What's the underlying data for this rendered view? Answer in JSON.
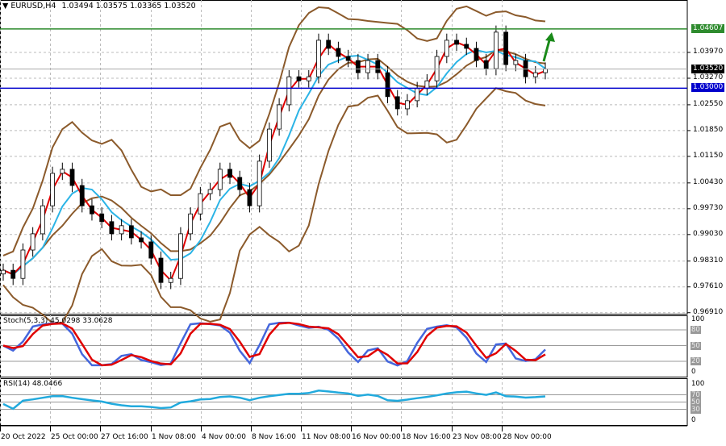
{
  "header": {
    "symbol_label": "EURUSD,H4",
    "ohlc": "1.03494 1.03575 1.03365 1.03520",
    "dropdown_icon": "triangle-down-icon"
  },
  "colors": {
    "band": "#8B5A2B",
    "fast_ma": "#e00000",
    "slow_ma": "#2bb4e6",
    "resistance": "#2e8b2e",
    "support": "#0000cc",
    "stoch_main": "#4466dd",
    "stoch_signal": "#e00000",
    "rsi": "#22aadd",
    "arrow": "#1a8a1a"
  },
  "chart_data": [
    {
      "type": "candlestick",
      "title": "EURUSD,H4",
      "ylim": [
        0.968,
        1.0485
      ],
      "price_ticks": [
        "1.03970",
        "1.03270",
        "1.02550",
        "1.01850",
        "1.01150",
        "1.00430",
        "0.99730",
        "0.99030",
        "0.98310",
        "0.97610",
        "0.96910"
      ],
      "current_price": "1.03520",
      "horizontal_lines": [
        {
          "name": "resistance",
          "value": "1.04607"
        },
        {
          "name": "support",
          "value": "1.03000"
        }
      ],
      "time_labels": [
        "20 Oct 2022",
        "25 Oct 00:00",
        "27 Oct 16:00",
        "1 Nov 08:00",
        "4 Nov 00:00",
        "8 Nov 16:00",
        "11 Nov 08:00",
        "16 Nov 00:00",
        "18 Nov 16:00",
        "23 Nov 08:00",
        "28 Nov 00:00"
      ],
      "closes": [
        0.9806,
        0.9784,
        0.9861,
        0.9905,
        0.9981,
        1.0069,
        1.008,
        1.0036,
        0.9981,
        0.9959,
        0.9938,
        0.9905,
        0.9927,
        0.9894,
        0.9883,
        0.9839,
        0.9773,
        0.9784,
        0.9905,
        0.9959,
        1.0014,
        1.0025,
        1.008,
        1.0058,
        1.0025,
        0.9981,
        1.0102,
        1.0189,
        1.0255,
        1.0331,
        1.032,
        1.0331,
        1.043,
        1.0408,
        1.0386,
        1.0375,
        1.0342,
        1.0375,
        1.0342,
        1.0277,
        1.0244,
        1.0266,
        1.0299,
        1.032,
        1.0386,
        1.043,
        1.0419,
        1.0408,
        1.0375,
        1.0353,
        1.0452,
        1.0364,
        1.0375,
        1.0331,
        1.0342,
        1.0352
      ]
    },
    {
      "type": "line",
      "title": "Stoch(5,3,3)",
      "label": "Stoch(5,3,3) 45.0298 33.0628",
      "ylim": [
        0,
        100
      ],
      "ticks": [
        "100",
        "80",
        "50",
        "20",
        "0"
      ]
    },
    {
      "type": "line",
      "title": "RSI(14)",
      "label": "RSI(14) 48.0466",
      "ylim": [
        0,
        100
      ],
      "ticks": [
        "100",
        "70",
        "50",
        "30",
        "0"
      ]
    }
  ]
}
